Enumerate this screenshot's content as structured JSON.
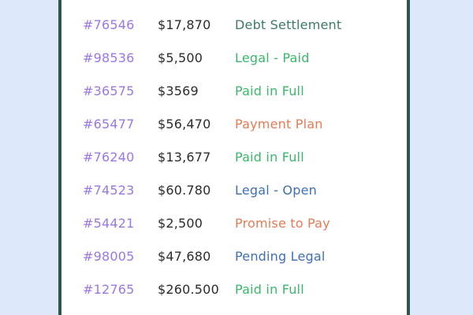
{
  "colors": {
    "background": "#dde8fb",
    "card_border": "#2e5648",
    "id_text": "#9a77e6",
    "amount_text": "#2b2b2b"
  },
  "status_colors": {
    "Debt Settlement": "#3d7a66",
    "Legal - Paid": "#39b86a",
    "Paid in Full": "#39b86a",
    "Payment Plan": "#e67b54",
    "Legal - Open": "#3f6fb6",
    "Promise to Pay": "#e67b54",
    "Pending Legal": "#3f6fb6"
  },
  "accounts": [
    {
      "id": "#76546",
      "amount": "$17,870",
      "status": "Debt Settlement"
    },
    {
      "id": "#98536",
      "amount": "$5,500",
      "status": "Legal - Paid"
    },
    {
      "id": "#36575",
      "amount": "$3569",
      "status": "Paid in Full"
    },
    {
      "id": "#65477",
      "amount": "$56,470",
      "status": "Payment Plan"
    },
    {
      "id": "#76240",
      "amount": "$13,677",
      "status": "Paid in Full"
    },
    {
      "id": "#74523",
      "amount": "$60.780",
      "status": "Legal - Open"
    },
    {
      "id": "#54421",
      "amount": "$2,500",
      "status": "Promise to Pay"
    },
    {
      "id": "#98005",
      "amount": "$47,680",
      "status": "Pending Legal"
    },
    {
      "id": "#12765",
      "amount": "$260.500",
      "status": "Paid in Full"
    }
  ]
}
